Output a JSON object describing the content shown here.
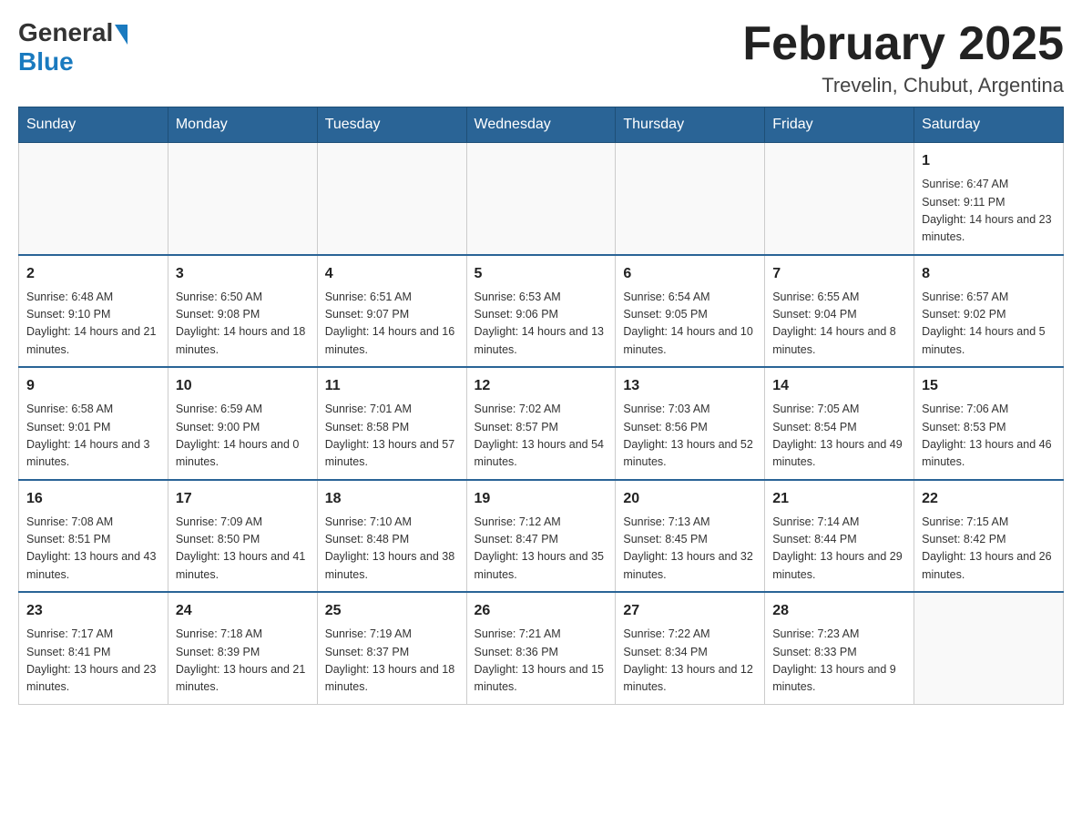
{
  "header": {
    "logo_general": "General",
    "logo_blue": "Blue",
    "month_title": "February 2025",
    "location": "Trevelin, Chubut, Argentina"
  },
  "days_of_week": [
    "Sunday",
    "Monday",
    "Tuesday",
    "Wednesday",
    "Thursday",
    "Friday",
    "Saturday"
  ],
  "weeks": [
    {
      "days": [
        {
          "num": "",
          "info": ""
        },
        {
          "num": "",
          "info": ""
        },
        {
          "num": "",
          "info": ""
        },
        {
          "num": "",
          "info": ""
        },
        {
          "num": "",
          "info": ""
        },
        {
          "num": "",
          "info": ""
        },
        {
          "num": "1",
          "info": "Sunrise: 6:47 AM\nSunset: 9:11 PM\nDaylight: 14 hours and 23 minutes."
        }
      ]
    },
    {
      "days": [
        {
          "num": "2",
          "info": "Sunrise: 6:48 AM\nSunset: 9:10 PM\nDaylight: 14 hours and 21 minutes."
        },
        {
          "num": "3",
          "info": "Sunrise: 6:50 AM\nSunset: 9:08 PM\nDaylight: 14 hours and 18 minutes."
        },
        {
          "num": "4",
          "info": "Sunrise: 6:51 AM\nSunset: 9:07 PM\nDaylight: 14 hours and 16 minutes."
        },
        {
          "num": "5",
          "info": "Sunrise: 6:53 AM\nSunset: 9:06 PM\nDaylight: 14 hours and 13 minutes."
        },
        {
          "num": "6",
          "info": "Sunrise: 6:54 AM\nSunset: 9:05 PM\nDaylight: 14 hours and 10 minutes."
        },
        {
          "num": "7",
          "info": "Sunrise: 6:55 AM\nSunset: 9:04 PM\nDaylight: 14 hours and 8 minutes."
        },
        {
          "num": "8",
          "info": "Sunrise: 6:57 AM\nSunset: 9:02 PM\nDaylight: 14 hours and 5 minutes."
        }
      ]
    },
    {
      "days": [
        {
          "num": "9",
          "info": "Sunrise: 6:58 AM\nSunset: 9:01 PM\nDaylight: 14 hours and 3 minutes."
        },
        {
          "num": "10",
          "info": "Sunrise: 6:59 AM\nSunset: 9:00 PM\nDaylight: 14 hours and 0 minutes."
        },
        {
          "num": "11",
          "info": "Sunrise: 7:01 AM\nSunset: 8:58 PM\nDaylight: 13 hours and 57 minutes."
        },
        {
          "num": "12",
          "info": "Sunrise: 7:02 AM\nSunset: 8:57 PM\nDaylight: 13 hours and 54 minutes."
        },
        {
          "num": "13",
          "info": "Sunrise: 7:03 AM\nSunset: 8:56 PM\nDaylight: 13 hours and 52 minutes."
        },
        {
          "num": "14",
          "info": "Sunrise: 7:05 AM\nSunset: 8:54 PM\nDaylight: 13 hours and 49 minutes."
        },
        {
          "num": "15",
          "info": "Sunrise: 7:06 AM\nSunset: 8:53 PM\nDaylight: 13 hours and 46 minutes."
        }
      ]
    },
    {
      "days": [
        {
          "num": "16",
          "info": "Sunrise: 7:08 AM\nSunset: 8:51 PM\nDaylight: 13 hours and 43 minutes."
        },
        {
          "num": "17",
          "info": "Sunrise: 7:09 AM\nSunset: 8:50 PM\nDaylight: 13 hours and 41 minutes."
        },
        {
          "num": "18",
          "info": "Sunrise: 7:10 AM\nSunset: 8:48 PM\nDaylight: 13 hours and 38 minutes."
        },
        {
          "num": "19",
          "info": "Sunrise: 7:12 AM\nSunset: 8:47 PM\nDaylight: 13 hours and 35 minutes."
        },
        {
          "num": "20",
          "info": "Sunrise: 7:13 AM\nSunset: 8:45 PM\nDaylight: 13 hours and 32 minutes."
        },
        {
          "num": "21",
          "info": "Sunrise: 7:14 AM\nSunset: 8:44 PM\nDaylight: 13 hours and 29 minutes."
        },
        {
          "num": "22",
          "info": "Sunrise: 7:15 AM\nSunset: 8:42 PM\nDaylight: 13 hours and 26 minutes."
        }
      ]
    },
    {
      "days": [
        {
          "num": "23",
          "info": "Sunrise: 7:17 AM\nSunset: 8:41 PM\nDaylight: 13 hours and 23 minutes."
        },
        {
          "num": "24",
          "info": "Sunrise: 7:18 AM\nSunset: 8:39 PM\nDaylight: 13 hours and 21 minutes."
        },
        {
          "num": "25",
          "info": "Sunrise: 7:19 AM\nSunset: 8:37 PM\nDaylight: 13 hours and 18 minutes."
        },
        {
          "num": "26",
          "info": "Sunrise: 7:21 AM\nSunset: 8:36 PM\nDaylight: 13 hours and 15 minutes."
        },
        {
          "num": "27",
          "info": "Sunrise: 7:22 AM\nSunset: 8:34 PM\nDaylight: 13 hours and 12 minutes."
        },
        {
          "num": "28",
          "info": "Sunrise: 7:23 AM\nSunset: 8:33 PM\nDaylight: 13 hours and 9 minutes."
        },
        {
          "num": "",
          "info": ""
        }
      ]
    }
  ]
}
